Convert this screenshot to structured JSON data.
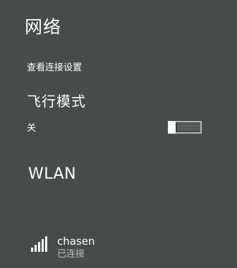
{
  "header": {
    "title": "网络"
  },
  "links": {
    "view_connection_settings": "查看连接设置"
  },
  "airplane_mode": {
    "title": "飞行模式",
    "state_label": "关",
    "enabled": false
  },
  "wlan": {
    "title": "WLAN",
    "networks": [
      {
        "name": "chasen",
        "status": "已连接",
        "signal_bars": 5,
        "signal_level": 5
      }
    ]
  },
  "colors": {
    "background": "#484b4b",
    "text": "#ffffff",
    "muted_text": "#bfc1c1",
    "toggle_border": "#b8b8b8"
  }
}
